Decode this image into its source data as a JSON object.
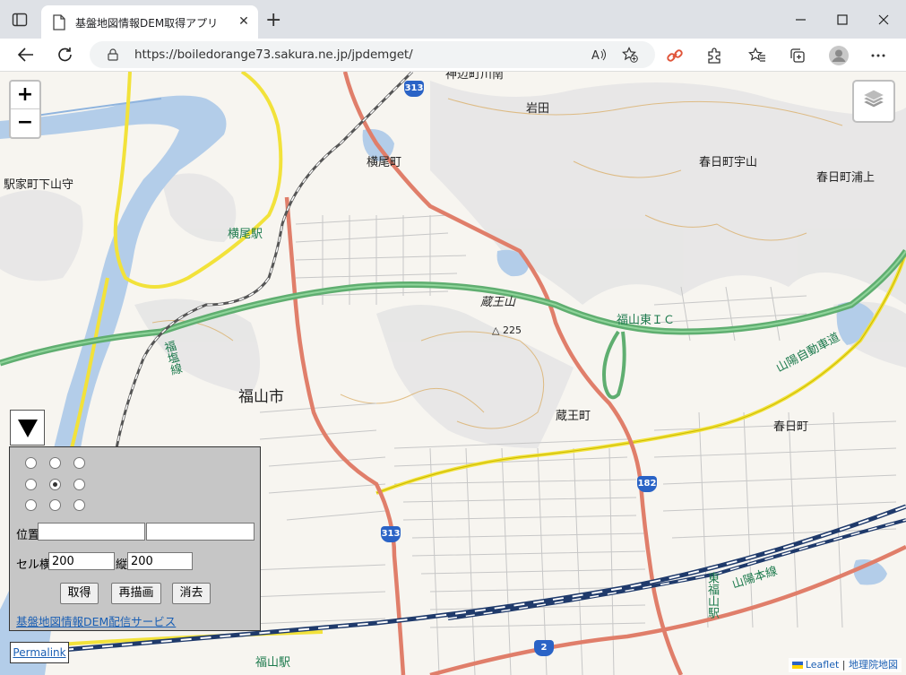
{
  "browser": {
    "tab_title": "基盤地図情報DEM取得アプリ",
    "url": "https://boiledorange73.sakura.ne.jp/jpdemget/"
  },
  "map": {
    "labels": {
      "iwata": "岩田",
      "yokoo": "横尾町",
      "kasugacho_uyama": "春日町宇山",
      "kasugacho_uragami": "春日町浦上",
      "ekiyacho": "駅家町下山守",
      "yokoo_station": "横尾駅",
      "zaouzan": "蔵王山",
      "elev": "225",
      "fukuyama_ic": "福山東ＩＣ",
      "fukuen_line": "福塩線",
      "fukuyama_city": "福山市",
      "zaoucho": "蔵王町",
      "kasugacho": "春日町",
      "sanyo_expressway": "山陽自動車道",
      "sanyo_line": "山陽本線",
      "higashi_fukuyama": "東福山駅",
      "fukuyama_station": "福山駅",
      "top_cut": "神辺町川南"
    },
    "shields": {
      "r313_top": "313",
      "r313": "313",
      "r182": "182",
      "r2": "2"
    },
    "zoom_in": "+",
    "zoom_out": "−"
  },
  "panel": {
    "position_label": "位置",
    "position_value1": "",
    "position_value2": "",
    "cell_x_label": "セル横",
    "cell_x_value": "200",
    "cell_y_label": "縦",
    "cell_y_value": "200",
    "btn_get": "取得",
    "btn_redraw": "再描画",
    "btn_clear": "消去",
    "link": "基盤地図情報DEM配信サービス",
    "selected_radio": 4
  },
  "permalink": "Permalink",
  "attribution": {
    "leaflet": "Leaflet",
    "sep": " | ",
    "gsi": "地理院地図"
  }
}
